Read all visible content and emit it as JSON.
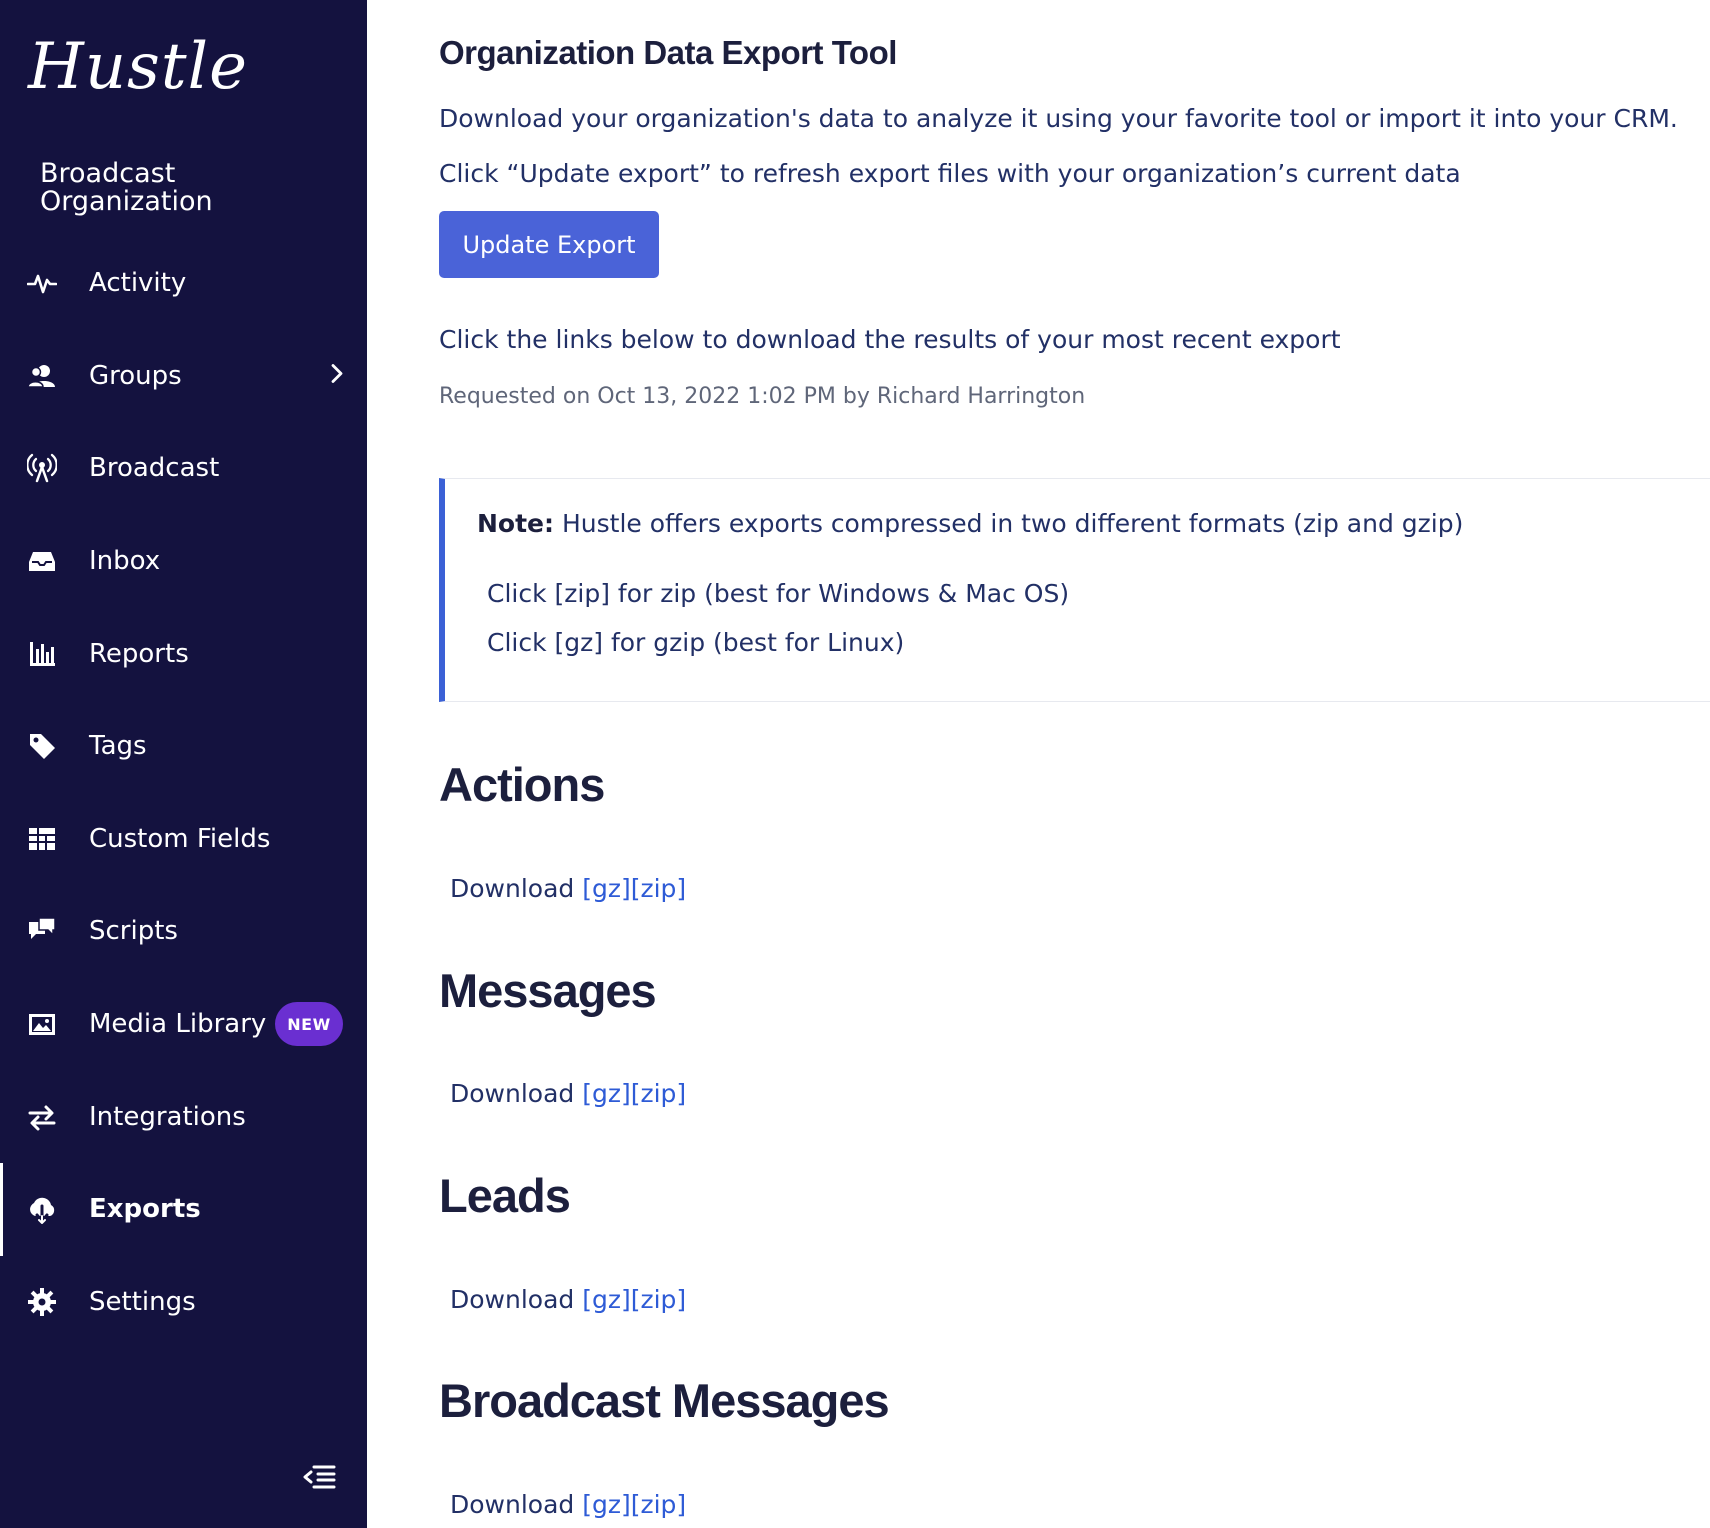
{
  "sidebar": {
    "brand": "Hustle",
    "org_name": "Broadcast Organization",
    "items": [
      {
        "label": "Activity",
        "icon": "activity-icon"
      },
      {
        "label": "Groups",
        "icon": "groups-icon"
      },
      {
        "label": "Broadcast",
        "icon": "broadcast-icon"
      },
      {
        "label": "Inbox",
        "icon": "inbox-icon"
      },
      {
        "label": "Reports",
        "icon": "reports-icon"
      },
      {
        "label": "Tags",
        "icon": "tag-icon"
      },
      {
        "label": "Custom Fields",
        "icon": "custom-fields-icon"
      },
      {
        "label": "Scripts",
        "icon": "scripts-icon"
      },
      {
        "label": "Media Library",
        "icon": "media-library-icon",
        "badge": "NEW"
      },
      {
        "label": "Integrations",
        "icon": "integrations-icon"
      },
      {
        "label": "Exports",
        "icon": "exports-icon",
        "active": true
      },
      {
        "label": "Settings",
        "icon": "gear-icon"
      }
    ],
    "colors": {
      "background": "#14123f",
      "badge": "#6a2fd1"
    }
  },
  "main": {
    "title": "Organization Data Export Tool",
    "intro": "Download your organization's data to analyze it using your favorite tool or import it into your CRM.",
    "update_hint": "Click “Update export” to refresh export files with your organization’s current data",
    "update_button": "Update Export",
    "links_hint": "Click the links below to download the results of your most recent export",
    "requested": "Requested on Oct 13, 2022 1:02 PM by Richard Harrington",
    "note": {
      "label": "Note:",
      "text": "Hustle offers exports compressed in two different formats (zip and gzip)",
      "zip_line": "Click [zip] for zip (best for Windows & Mac OS)",
      "gz_line": "Click [gz] for gzip (best for Linux)"
    },
    "sections": [
      {
        "heading": "Actions",
        "download": "Download",
        "gz": "[gz]",
        "zip": "[zip]"
      },
      {
        "heading": "Messages",
        "download": "Download",
        "gz": "[gz]",
        "zip": "[zip]"
      },
      {
        "heading": "Leads",
        "download": "Download",
        "gz": "[gz]",
        "zip": "[zip]"
      },
      {
        "heading": "Broadcast Messages",
        "download": "Download",
        "gz": "[gz]",
        "zip": "[zip]"
      }
    ],
    "colors": {
      "accent": "#4a63d8",
      "link": "#2e5bd6",
      "note_border": "#3b61d6"
    }
  }
}
